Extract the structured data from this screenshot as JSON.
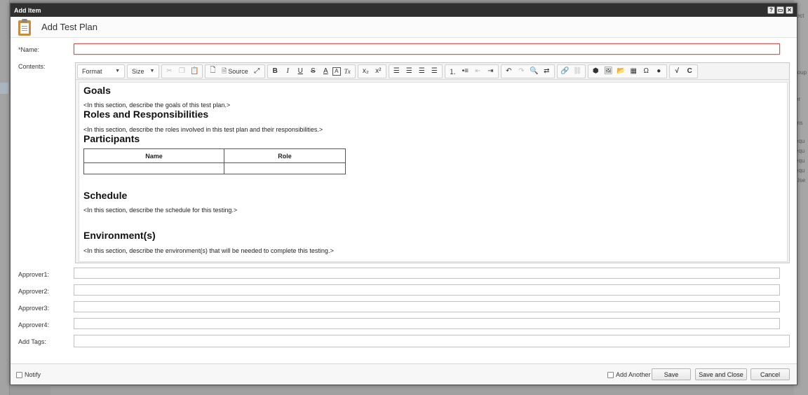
{
  "background": {
    "right_snippets": [
      "ject",
      "roup",
      "er",
      "ms",
      "equ",
      "equ",
      "equ",
      "equ",
      "Use"
    ]
  },
  "dialog": {
    "title": "Add Item",
    "title_buttons": [
      "?",
      "▭",
      "✕"
    ],
    "header_title": "Add Test Plan"
  },
  "form": {
    "name_label": "*Name:",
    "name_value": "",
    "contents_label": "Contents:",
    "approver1_label": "Approver1:",
    "approver2_label": "Approver2:",
    "approver3_label": "Approver3:",
    "approver4_label": "Approver4:",
    "tags_label": "Add Tags:"
  },
  "toolbar": {
    "format_label": "Format",
    "size_label": "Size",
    "source_label": "Source",
    "bold": "B",
    "italic": "I",
    "underline": "U",
    "strike": "S",
    "text_color": "A",
    "bg_color": "A",
    "remove_format": "Tx",
    "subscript": "x₂",
    "superscript": "x²"
  },
  "content": {
    "goals_heading": "Goals",
    "goals_text": "<In this section, describe the goals of this test plan.>",
    "roles_heading": "Roles and Responsibilities",
    "roles_text": "<In this section, describe the roles involved in this test plan and their responsibilities.>",
    "participants_heading": "Participants",
    "table_headers": [
      "Name",
      "Role"
    ],
    "schedule_heading": "Schedule",
    "schedule_text": "<In this section, describe the schedule for this testing.>",
    "environment_heading": "Environment(s)",
    "environment_text": "<In this section, describe the environment(s) that will be needed to complete this testing.>"
  },
  "footer": {
    "notify_label": "Notify",
    "add_another_label": "Add Another",
    "save_label": "Save",
    "save_close_label": "Save and Close",
    "cancel_label": "Cancel"
  }
}
